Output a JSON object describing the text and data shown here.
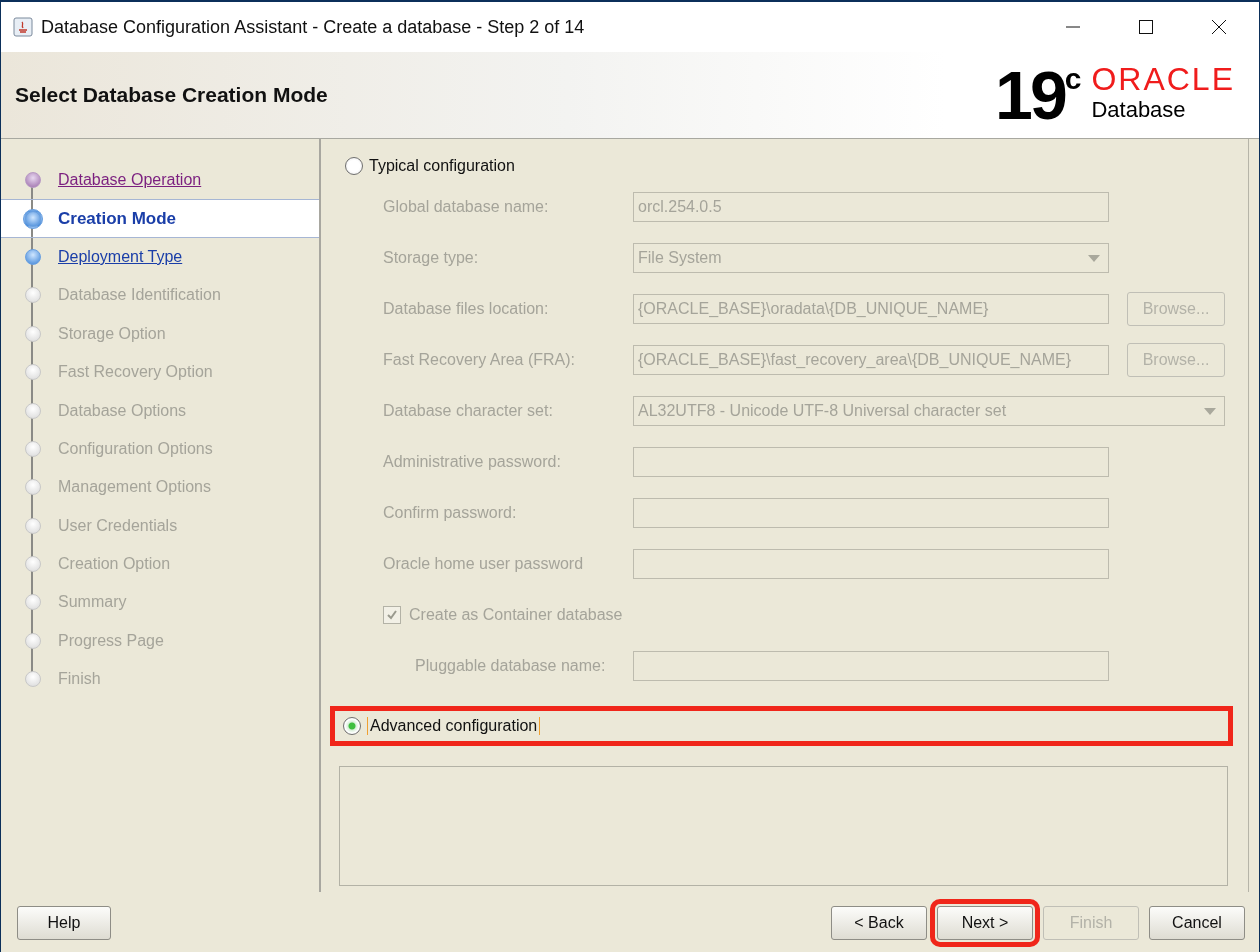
{
  "window": {
    "title": "Database Configuration Assistant - Create a database - Step 2 of 14"
  },
  "header": {
    "title": "Select Database Creation Mode",
    "logo_version": "19",
    "logo_suffix": "c",
    "logo_brand": "ORACLE",
    "logo_product": "Database"
  },
  "steps": [
    {
      "label": "Database Operation",
      "visited": true,
      "disabled": false,
      "selected": false
    },
    {
      "label": "Creation Mode",
      "visited": false,
      "disabled": false,
      "selected": true
    },
    {
      "label": "Deployment Type",
      "visited": false,
      "disabled": false,
      "selected": false
    },
    {
      "label": "Database Identification",
      "visited": false,
      "disabled": true,
      "selected": false
    },
    {
      "label": "Storage Option",
      "visited": false,
      "disabled": true,
      "selected": false
    },
    {
      "label": "Fast Recovery Option",
      "visited": false,
      "disabled": true,
      "selected": false
    },
    {
      "label": "Database Options",
      "visited": false,
      "disabled": true,
      "selected": false
    },
    {
      "label": "Configuration Options",
      "visited": false,
      "disabled": true,
      "selected": false
    },
    {
      "label": "Management Options",
      "visited": false,
      "disabled": true,
      "selected": false
    },
    {
      "label": "User Credentials",
      "visited": false,
      "disabled": true,
      "selected": false
    },
    {
      "label": "Creation Option",
      "visited": false,
      "disabled": true,
      "selected": false
    },
    {
      "label": "Summary",
      "visited": false,
      "disabled": true,
      "selected": false
    },
    {
      "label": "Progress Page",
      "visited": false,
      "disabled": true,
      "selected": false
    },
    {
      "label": "Finish",
      "visited": false,
      "disabled": true,
      "selected": false
    }
  ],
  "typical": {
    "label": "Typical configuration",
    "selected": false,
    "fields": [
      {
        "kind": "text",
        "label": "Global database name:",
        "value": "orcl.254.0.5",
        "disabled": true
      },
      {
        "kind": "select",
        "label": "Storage type:",
        "value": "File System",
        "disabled": true
      },
      {
        "kind": "browse",
        "label": "Database files location:",
        "value": "{ORACLE_BASE}\\oradata\\{DB_UNIQUE_NAME}",
        "button": "Browse...",
        "disabled": true
      },
      {
        "kind": "browse",
        "label": "Fast Recovery Area (FRA):",
        "value": "{ORACLE_BASE}\\fast_recovery_area\\{DB_UNIQUE_NAME}",
        "button": "Browse...",
        "disabled": true
      },
      {
        "kind": "wide-select",
        "label": "Database character set:",
        "value": "AL32UTF8 - Unicode UTF-8 Universal character set",
        "disabled": true
      },
      {
        "kind": "password",
        "label": "Administrative password:",
        "disabled": true
      },
      {
        "kind": "password",
        "label": "Confirm password:",
        "disabled": true
      },
      {
        "kind": "password",
        "label": "Oracle home user password",
        "disabled": true
      },
      {
        "kind": "checkbox",
        "label": "Create as Container database",
        "checked": true,
        "disabled": true
      },
      {
        "kind": "indented-text",
        "label": "Pluggable database name:",
        "disabled": true
      }
    ]
  },
  "advanced": {
    "label": "Advanced configuration",
    "selected": true,
    "highlighted": true
  },
  "help_button": {
    "label": "Help",
    "disabled": false,
    "highlighted": false
  },
  "buttons": [
    {
      "label": "< Back",
      "disabled": false,
      "highlighted": false
    },
    {
      "label": "Next >",
      "disabled": false,
      "highlighted": true
    },
    {
      "label": "Finish",
      "disabled": true,
      "highlighted": false
    },
    {
      "label": "Cancel",
      "disabled": false,
      "highlighted": false
    }
  ]
}
